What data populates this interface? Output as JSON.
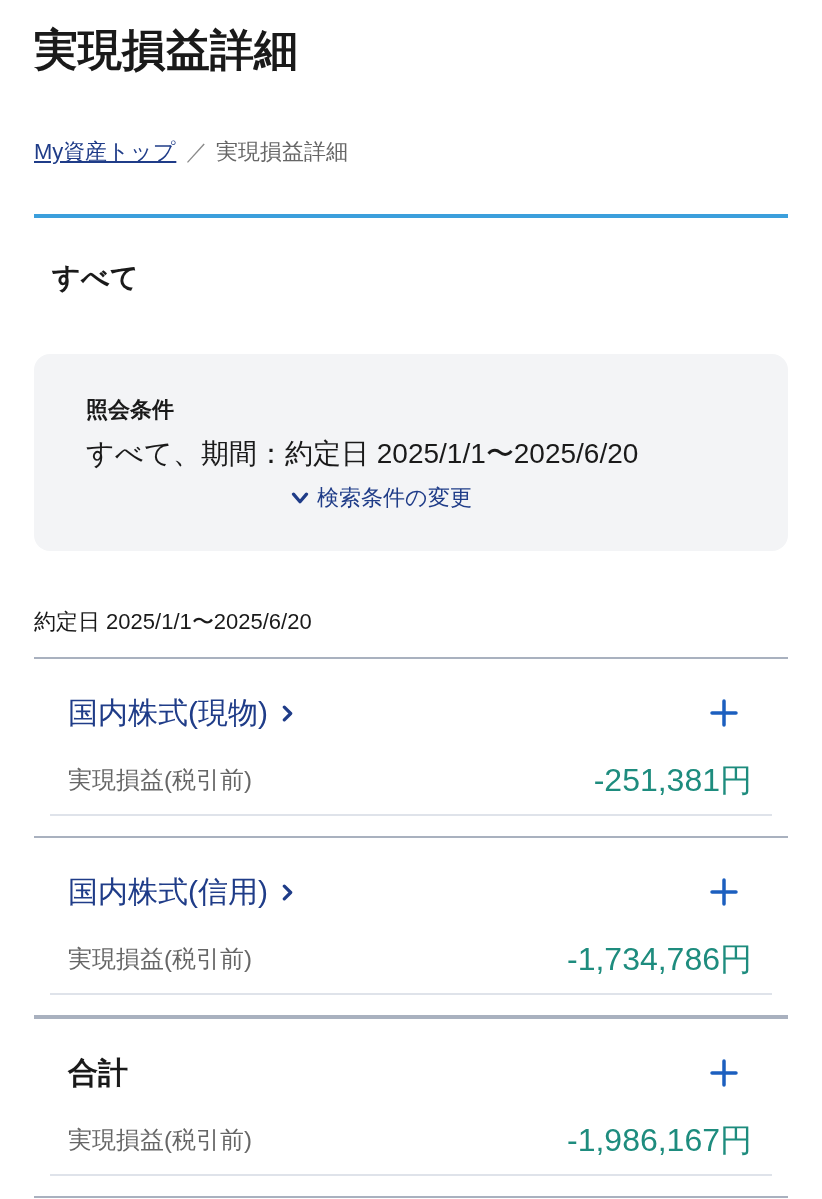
{
  "page": {
    "title": "実現損益詳細"
  },
  "breadcrumb": {
    "separator": "／",
    "items": [
      {
        "label": "My資産トップ",
        "kind": "link"
      },
      {
        "label": "実現損益詳細",
        "kind": "current"
      }
    ]
  },
  "section_heading": "すべて",
  "query": {
    "title": "照会条件",
    "summary": "すべて、期間：約定日 2025/1/1〜2025/6/20",
    "change_link": "検索条件の変更"
  },
  "period_label": "約定日 2025/1/1〜2025/6/20",
  "groups": [
    {
      "kind": "category",
      "name": "国内株式(現物)",
      "expanded": false,
      "rows": [
        {
          "label": "実現損益(税引前)",
          "value": "-251,381円"
        }
      ]
    },
    {
      "kind": "category",
      "name": "国内株式(信用)",
      "expanded": false,
      "rows": [
        {
          "label": "実現損益(税引前)",
          "value": "-1,734,786円"
        }
      ]
    },
    {
      "kind": "total",
      "name": "合計",
      "expanded": false,
      "rows": [
        {
          "label": "実現損益(税引前)",
          "value": "-1,986,167円"
        }
      ]
    }
  ]
}
